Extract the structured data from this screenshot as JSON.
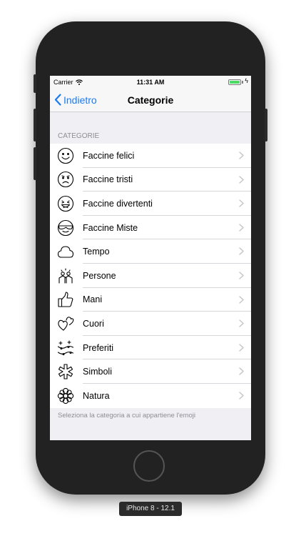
{
  "status_bar": {
    "carrier": "Carrier",
    "time": "11:31 AM",
    "battery_level": 1.0
  },
  "nav": {
    "back_label": "Indietro",
    "title": "Categorie"
  },
  "section_header": "CATEGORIE",
  "categories": [
    {
      "label": "Faccine felici",
      "icon": "smiley-face-icon"
    },
    {
      "label": "Faccine tristi",
      "icon": "sad-face-icon"
    },
    {
      "label": "Faccine divertenti",
      "icon": "grinning-face-icon"
    },
    {
      "label": "Faccine Miste",
      "icon": "sunglasses-face-icon"
    },
    {
      "label": "Tempo",
      "icon": "cloud-icon"
    },
    {
      "label": "Persone",
      "icon": "people-icon"
    },
    {
      "label": "Mani",
      "icon": "thumbs-up-icon"
    },
    {
      "label": "Cuori",
      "icon": "hearts-icon"
    },
    {
      "label": "Preferiti",
      "icon": "party-icon"
    },
    {
      "label": "Simboli",
      "icon": "medical-cross-icon"
    },
    {
      "label": "Natura",
      "icon": "flower-icon"
    }
  ],
  "footer_text": "Seleziona la categoria a cui appartiene l'emoji",
  "device_label": "iPhone 8 - 12.1",
  "colors": {
    "tint": "#1a7bf2",
    "battery": "#4cd964",
    "secondary_text": "#8e8e93"
  }
}
